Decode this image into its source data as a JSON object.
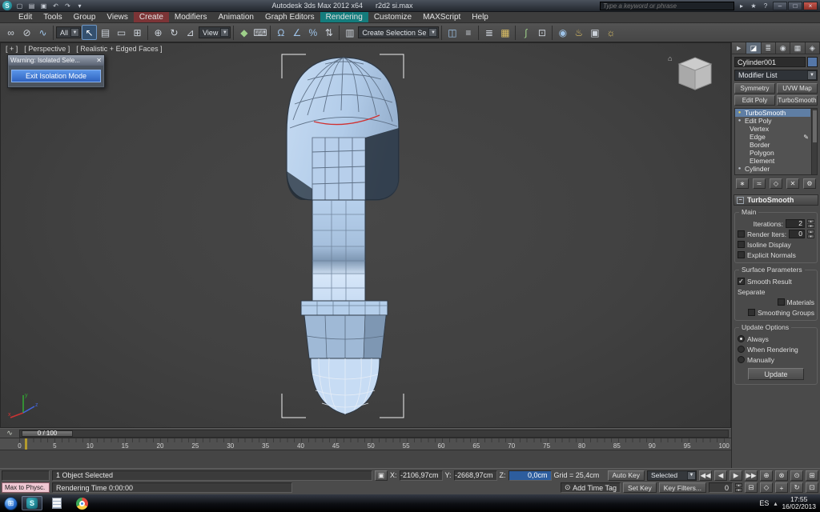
{
  "ui": {
    "dropdown_arrow": "▼",
    "spin_up": "▲",
    "spin_down": "▼",
    "check": "✓",
    "minus": "−",
    "close": "✕",
    "bulb": "●",
    "pencil": "✎",
    "lock": "▣",
    "clock": "⊙",
    "home": "⌂",
    "start": "⊞",
    "s_logo": "S",
    "tray_up": "▴"
  },
  "colors": {
    "accent_blue": "#3f6fb5",
    "warning_button_blue": "#2f63c0",
    "selection_highlight": "#5f7ea4",
    "listener_pink": "#efc7d2",
    "model_fill": "#b9d3ef",
    "current_frame_yellow": "#b39b2e"
  },
  "titlebar": {
    "app_title": "Autodesk 3ds Max 2012 x64",
    "file_title": "r2d2 si.max",
    "search_placeholder": "Type a keyword or phrase",
    "qat_icons": [
      {
        "name": "new-scene",
        "glyph": "▢"
      },
      {
        "name": "open-file",
        "glyph": "▤"
      },
      {
        "name": "save-file",
        "glyph": "▣"
      },
      {
        "name": "undo",
        "glyph": "↶"
      },
      {
        "name": "redo",
        "glyph": "↷"
      },
      {
        "name": "qat-menu",
        "glyph": "▾"
      }
    ],
    "info_icons": [
      {
        "name": "search-go",
        "glyph": "▸"
      },
      {
        "name": "infocenter-star",
        "glyph": "★"
      },
      {
        "name": "help-menu",
        "glyph": "?"
      }
    ],
    "minimize": "–",
    "maximize": "□",
    "close": "×"
  },
  "menubar": {
    "items": [
      "Edit",
      "Tools",
      "Group",
      "Views",
      "Create",
      "Modifiers",
      "Animation",
      "Graph Editors",
      "Rendering",
      "Customize",
      "MAXScript",
      "Help"
    ]
  },
  "toolbar": {
    "filter_value": "All",
    "coord_value": "View",
    "selset_value": "Create Selection Se",
    "icons": [
      {
        "name": "select-and-link",
        "glyph": "∞"
      },
      {
        "name": "unlink-selection",
        "glyph": "⊘"
      },
      {
        "name": "bind-to-space-warp",
        "glyph": "∿"
      },
      {
        "name": "select-object",
        "glyph": "↖"
      },
      {
        "name": "select-by-name",
        "glyph": "▤"
      },
      {
        "name": "rectangular-selection-region",
        "glyph": "▭"
      },
      {
        "name": "window-crossing-toggle",
        "glyph": "⊞"
      },
      {
        "name": "select-and-move",
        "glyph": "⊕"
      },
      {
        "name": "select-and-rotate",
        "glyph": "↻"
      },
      {
        "name": "select-and-scale",
        "glyph": "⊿"
      },
      {
        "name": "select-and-manipulate",
        "glyph": "◆"
      },
      {
        "name": "keyboard-shortcut-override",
        "glyph": "⌨"
      },
      {
        "name": "snaps-toggle",
        "glyph": "Ω"
      },
      {
        "name": "angle-snap-toggle",
        "glyph": "∠"
      },
      {
        "name": "percent-snap-toggle",
        "glyph": "%"
      },
      {
        "name": "spinner-snap-toggle",
        "glyph": "⇅"
      },
      {
        "name": "edit-named-selection-sets",
        "glyph": "▥"
      },
      {
        "name": "mirror",
        "glyph": "◫"
      },
      {
        "name": "align",
        "glyph": "≡"
      },
      {
        "name": "layer-manager",
        "glyph": "≣"
      },
      {
        "name": "graphite-ribbon-toggle",
        "glyph": "▦"
      },
      {
        "name": "curve-editor",
        "glyph": "∫"
      },
      {
        "name": "schematic-view",
        "glyph": "⊡"
      },
      {
        "name": "material-editor",
        "glyph": "◉"
      },
      {
        "name": "render-setup",
        "glyph": "♨"
      },
      {
        "name": "rendered-frame-window",
        "glyph": "▣"
      },
      {
        "name": "render-production",
        "glyph": "☼"
      }
    ]
  },
  "viewport": {
    "label_plus": "[ + ]",
    "label_view": "[ Perspective ]",
    "label_shading": "[ Realistic + Edged Faces ]",
    "warning": {
      "title": "Warning: Isolated Sele...",
      "button": "Exit Isolation Mode"
    }
  },
  "panel": {
    "tabs": [
      {
        "name": "create",
        "glyph": "►"
      },
      {
        "name": "modify",
        "glyph": "◪"
      },
      {
        "name": "hierarchy",
        "glyph": "≣"
      },
      {
        "name": "motion",
        "glyph": "◉"
      },
      {
        "name": "display",
        "glyph": "▦"
      },
      {
        "name": "utilities",
        "glyph": "◈"
      }
    ],
    "object_name": "Cylinder001",
    "modifier_list_label": "Modifier List",
    "modifier_sets": [
      "Symmetry",
      "UVW Map",
      "Edit Poly",
      "TurboSmooth"
    ],
    "stack": [
      {
        "label": "TurboSmooth"
      },
      {
        "label": "Edit Poly"
      },
      {
        "label": "Vertex"
      },
      {
        "label": "Edge"
      },
      {
        "label": "Border"
      },
      {
        "label": "Polygon"
      },
      {
        "label": "Element"
      },
      {
        "label": "Cylinder"
      }
    ],
    "stack_tools": [
      {
        "name": "pin-stack",
        "glyph": "∗"
      },
      {
        "name": "show-end-result",
        "glyph": "≍"
      },
      {
        "name": "make-unique",
        "glyph": "◇"
      },
      {
        "name": "remove-modifier",
        "glyph": "✕"
      },
      {
        "name": "configure-modifier-sets",
        "glyph": "⚙"
      }
    ],
    "rollout": {
      "title": "TurboSmooth",
      "group_main": "Main",
      "iterations_label": "Iterations:",
      "iterations_value": "2",
      "render_iters_label": "Render Iters:",
      "render_iters_value": "0",
      "isoline_label": "Isoline Display",
      "explicit_label": "Explicit Normals",
      "group_surface": "Surface Parameters",
      "smooth_result_label": "Smooth Result",
      "separate_label": "Separate",
      "materials_label": "Materials",
      "smoothing_groups_label": "Smoothing Groups",
      "group_update": "Update Options",
      "always_label": "Always",
      "when_rendering_label": "When Rendering",
      "manually_label": "Manually",
      "update_button": "Update"
    }
  },
  "timeline": {
    "slider_label": "0 / 100",
    "ticks": [
      "0",
      "5",
      "10",
      "15",
      "20",
      "25",
      "30",
      "35",
      "40",
      "45",
      "50",
      "55",
      "60",
      "65",
      "70",
      "75",
      "80",
      "85",
      "90",
      "95",
      "100"
    ]
  },
  "statusbar": {
    "selection_status": "1 Object Selected",
    "coord_x_label": "X:",
    "coord_x_value": "-2106,97cm",
    "coord_y_label": "Y:",
    "coord_y_value": "-2668,97cm",
    "coord_z_label": "Z:",
    "coord_z_value": "0,0cm",
    "grid_label": "Grid = 25,4cm",
    "listener_text": "Max to Physc.",
    "prompt_text": "Rendering Time  0:00:00",
    "add_time_tag": "Add Time Tag",
    "auto_key": "Auto Key",
    "selected_filter": "Selected",
    "set_key": "Set Key",
    "key_filters": "Key Filters...",
    "frame_value": "0",
    "playback": [
      {
        "name": "go-to-start",
        "glyph": "◀◀"
      },
      {
        "name": "previous-frame",
        "glyph": "◀"
      },
      {
        "name": "play-animation",
        "glyph": "▶"
      },
      {
        "name": "go-to-end",
        "glyph": "▶▶"
      }
    ],
    "nav_row1": [
      {
        "name": "zoom",
        "glyph": "⊕"
      },
      {
        "name": "zoom-all",
        "glyph": "⊗"
      },
      {
        "name": "zoom-extents",
        "glyph": "⊙"
      },
      {
        "name": "zoom-extents-all",
        "glyph": "⊞"
      }
    ],
    "nav_row2": [
      {
        "name": "field-of-view",
        "glyph": "◇"
      },
      {
        "name": "pan-view",
        "glyph": "+"
      },
      {
        "name": "orbit",
        "glyph": "↻"
      },
      {
        "name": "maximize-viewport-toggle",
        "glyph": "⊡"
      }
    ],
    "time_config": {
      "name": "time-configuration",
      "glyph": "⊟"
    }
  },
  "taskbar": {
    "language": "ES",
    "time": "17:55",
    "date": "16/02/2013"
  }
}
